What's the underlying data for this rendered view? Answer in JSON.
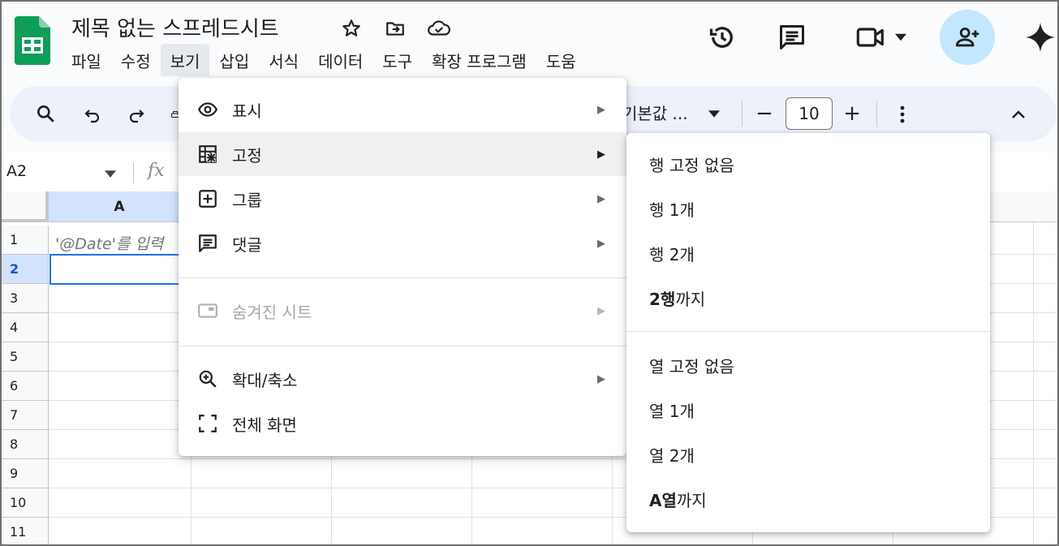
{
  "app": {
    "title": "제목 없는 스프레드시트",
    "menu": [
      "파일",
      "수정",
      "보기",
      "삽입",
      "서식",
      "데이터",
      "도구",
      "확장 프로그램",
      "도움"
    ],
    "active_menu": "보기"
  },
  "toolbar": {
    "font": "기본값 ...",
    "font_size": "10",
    "minus": "−",
    "plus": "+"
  },
  "formula_bar": {
    "name_box": "A2",
    "fx": "fx"
  },
  "sheet": {
    "columns": [
      "A"
    ],
    "rows": [
      "1",
      "2",
      "3",
      "4",
      "5",
      "6",
      "7",
      "8",
      "9",
      "10",
      "11"
    ],
    "selected_row": "2",
    "a1_text": "'@Date'를 입력"
  },
  "view_menu": {
    "items": [
      {
        "label": "표시",
        "icon": "eye-icon",
        "submenu": true
      },
      {
        "label": "고정",
        "icon": "freeze-icon",
        "submenu": true
      },
      {
        "label": "그룹",
        "icon": "group-icon",
        "submenu": true
      },
      {
        "label": "댓글",
        "icon": "comment-icon",
        "submenu": true
      },
      {
        "label": "숨겨진 시트",
        "icon": "hidden-sheet-icon",
        "submenu": true,
        "disabled": true
      },
      {
        "label": "확대/축소",
        "icon": "zoom-icon",
        "submenu": true
      },
      {
        "label": "전체 화면",
        "icon": "fullscreen-icon",
        "submenu": false
      }
    ],
    "arrow": "▶"
  },
  "freeze_submenu": {
    "rows": [
      "행 고정 없음",
      "행 1개",
      "행 2개"
    ],
    "rows_upto_bold": "2행",
    "rows_upto_rest": "까지",
    "cols": [
      "열 고정 없음",
      "열 1개",
      "열 2개"
    ],
    "cols_upto_bold": "A열",
    "cols_upto_rest": "까지"
  },
  "colors": {
    "accent": "#1a73e8",
    "share_bg": "#c2e7ff",
    "toolbar_bg": "#edf2fa",
    "sheets_green": "#0f9d58"
  }
}
